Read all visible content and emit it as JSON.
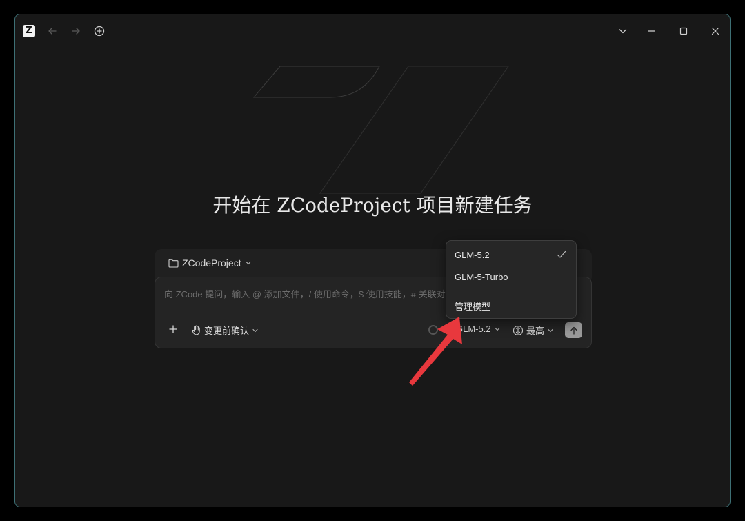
{
  "titlebar": {
    "logo_text": "Z",
    "back_icon": "arrow-left-icon",
    "forward_icon": "arrow-right-icon",
    "new_task_icon": "plus-circle-icon",
    "window_controls": [
      "chevron-down-icon",
      "minimize-icon",
      "maximize-icon",
      "close-icon"
    ]
  },
  "main": {
    "title": "开始在 ZCodeProject 项目新建任务"
  },
  "composer": {
    "project_name": "ZCodeProject",
    "placeholder": "向 ZCode 提问，输入 @ 添加文件，/ 使用命令，$ 使用技能，# 关联对",
    "approval_mode": "变更前确认",
    "model": "GLM-5.2",
    "effort": "最高"
  },
  "model_menu": {
    "items": [
      {
        "label": "GLM-5.2",
        "selected": true
      },
      {
        "label": "GLM-5-Turbo",
        "selected": false
      }
    ],
    "manage_label": "管理模型"
  },
  "colors": {
    "background": "#181818",
    "window_border": "#3d6f74",
    "annotation_arrow": "#e8383d"
  }
}
